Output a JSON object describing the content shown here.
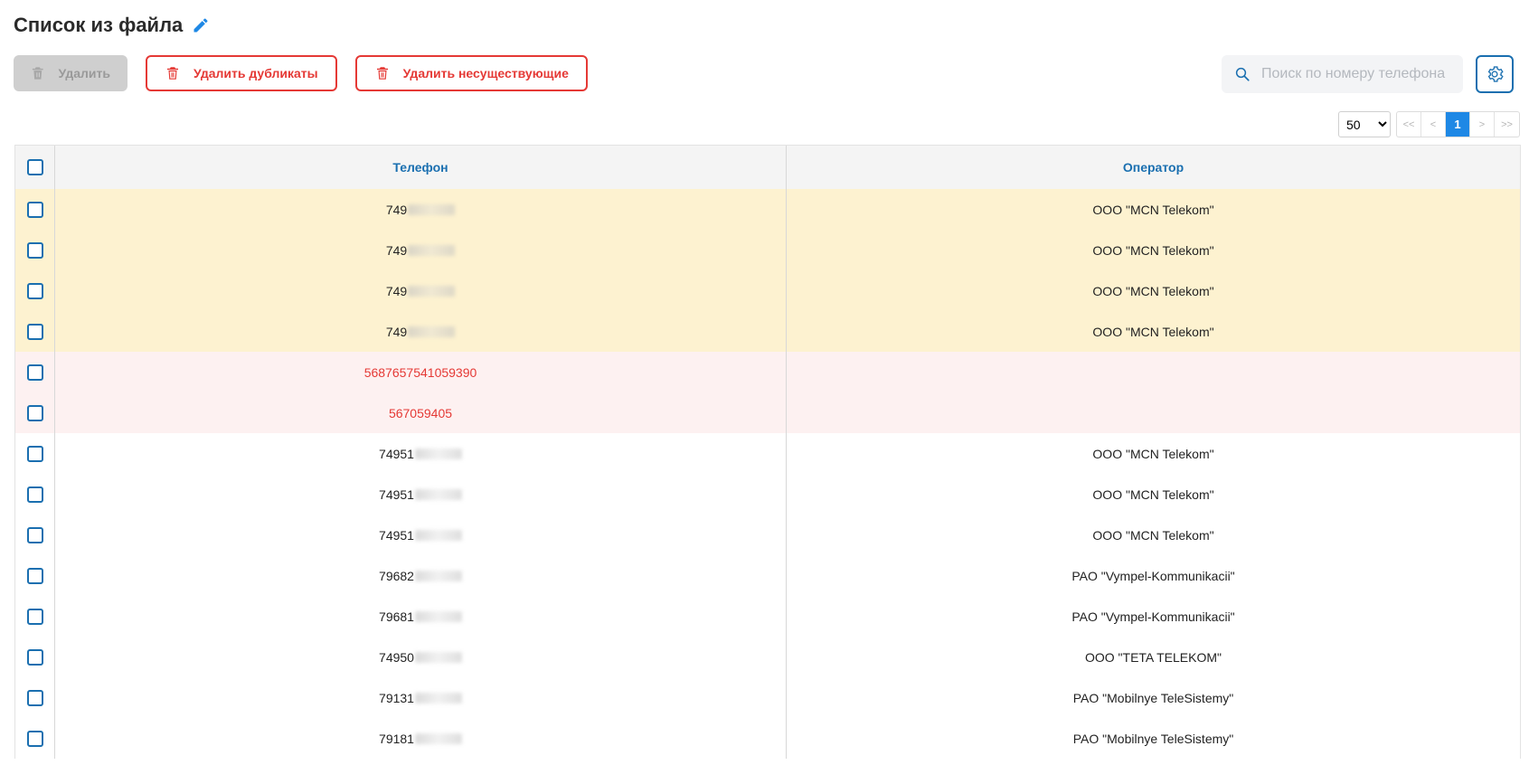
{
  "header": {
    "title": "Список из файла",
    "edit_icon": "pencil-icon"
  },
  "toolbar": {
    "delete_label": "Удалить",
    "delete_duplicates_label": "Удалить дубликаты",
    "delete_nonexistent_label": "Удалить несуществующие"
  },
  "search": {
    "placeholder": "Поиск по номеру телефона"
  },
  "pagination": {
    "page_size": "50",
    "page_size_options": [
      "50"
    ],
    "first": "<<",
    "prev": "<",
    "current": "1",
    "next": ">",
    "last": ">>"
  },
  "table": {
    "columns": {
      "phone": "Телефон",
      "operator": "Оператор"
    },
    "rows": [
      {
        "phone": "749",
        "blurred": true,
        "operator": "ООО \"MCN Telekom\"",
        "status": "duplicate"
      },
      {
        "phone": "749",
        "blurred": true,
        "operator": "ООО \"MCN Telekom\"",
        "status": "duplicate"
      },
      {
        "phone": "749",
        "blurred": true,
        "operator": "ООО \"MCN Telekom\"",
        "status": "duplicate"
      },
      {
        "phone": "749",
        "blurred": true,
        "operator": "ООО \"MCN Telekom\"",
        "status": "duplicate"
      },
      {
        "phone": "5687657541059390",
        "blurred": false,
        "operator": "",
        "status": "invalid"
      },
      {
        "phone": "567059405",
        "blurred": false,
        "operator": "",
        "status": "invalid"
      },
      {
        "phone": "74951",
        "blurred": true,
        "operator": "ООО \"MCN Telekom\"",
        "status": "normal"
      },
      {
        "phone": "74951",
        "blurred": true,
        "operator": "ООО \"MCN Telekom\"",
        "status": "normal"
      },
      {
        "phone": "74951",
        "blurred": true,
        "operator": "ООО \"MCN Telekom\"",
        "status": "normal"
      },
      {
        "phone": "79682",
        "blurred": true,
        "operator": "PAO \"Vympel-Kommunikacii\"",
        "status": "normal"
      },
      {
        "phone": "79681",
        "blurred": true,
        "operator": "PAO \"Vympel-Kommunikacii\"",
        "status": "normal"
      },
      {
        "phone": "74950",
        "blurred": true,
        "operator": "ООО \"TETA TELEKOM\"",
        "status": "normal"
      },
      {
        "phone": "79131",
        "blurred": true,
        "operator": "PAO \"Mobilnye TeleSistemy\"",
        "status": "normal"
      },
      {
        "phone": "79181",
        "blurred": true,
        "operator": "PAO \"Mobilnye TeleSistemy\"",
        "status": "normal"
      }
    ]
  },
  "colors": {
    "accent": "#1a6fb0",
    "danger": "#e53935",
    "duplicate_bg": "#fdf2d0",
    "invalid_bg": "#fdf1f1",
    "active_page": "#1e88e5"
  }
}
